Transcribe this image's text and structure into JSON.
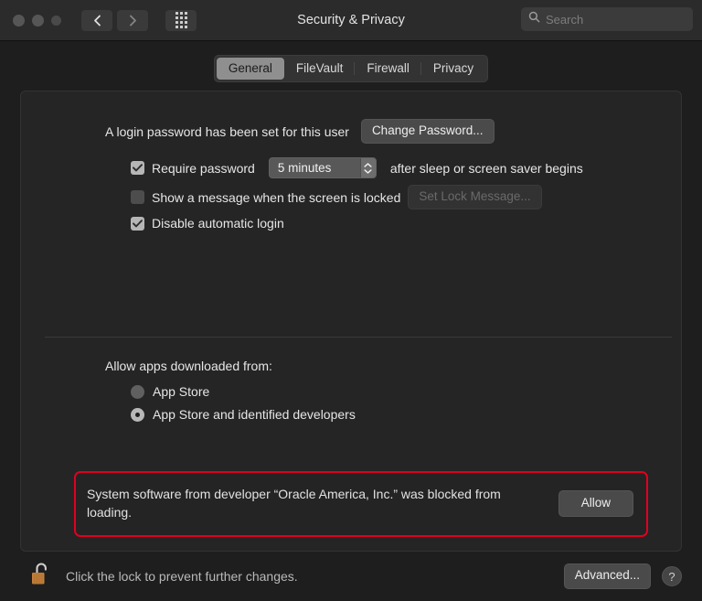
{
  "window": {
    "title": "Security & Privacy",
    "traffic_lights": [
      "close",
      "minimize",
      "zoom"
    ],
    "nav": {
      "back_icon": "chevron-left-icon",
      "forward_icon": "chevron-right-icon",
      "grid_icon": "show-all-grid-icon"
    },
    "search": {
      "placeholder": "Search",
      "value": "",
      "icon": "search-icon"
    }
  },
  "tabs": [
    {
      "label": "General",
      "active": true
    },
    {
      "label": "FileVault",
      "active": false
    },
    {
      "label": "Firewall",
      "active": false
    },
    {
      "label": "Privacy",
      "active": false
    }
  ],
  "general": {
    "password_status": "A login password has been set for this user",
    "change_password_label": "Change Password...",
    "require_password": {
      "checked": true,
      "label_before": "Require password",
      "interval_value": "5 minutes",
      "label_after": "after sleep or screen saver begins"
    },
    "lock_message": {
      "checked": false,
      "label": "Show a message when the screen is locked",
      "button_label": "Set Lock Message...",
      "button_disabled": true
    },
    "disable_auto_login": {
      "checked": true,
      "label": "Disable automatic login"
    }
  },
  "allow_apps": {
    "title": "Allow apps downloaded from:",
    "options": [
      {
        "label": "App Store",
        "selected": false
      },
      {
        "label": "App Store and identified developers",
        "selected": true
      }
    ]
  },
  "alert": {
    "message": "System software from developer “Oracle America, Inc.” was blocked from loading.",
    "button_label": "Allow",
    "border_color": "#e00020"
  },
  "bottom": {
    "lock_icon": "padlock-open-icon",
    "lock_text": "Click the lock to prevent further changes.",
    "advanced_label": "Advanced...",
    "help_label": "?"
  }
}
